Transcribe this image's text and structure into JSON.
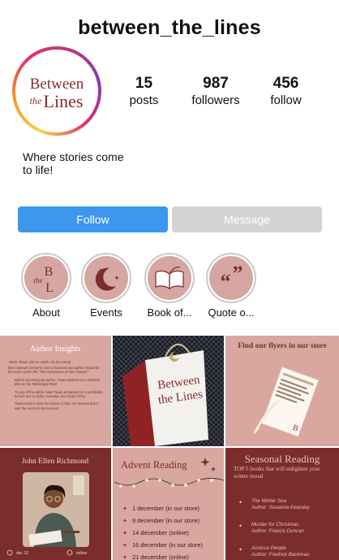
{
  "profile": {
    "username": "between_the_lines",
    "logo_line1": "Between",
    "logo_the": "the",
    "logo_line2": "Lines",
    "bio": "Where stories come to life!"
  },
  "stats": [
    {
      "value": "15",
      "label": "posts"
    },
    {
      "value": "987",
      "label": "followers"
    },
    {
      "value": "456",
      "label": "follow"
    }
  ],
  "buttons": {
    "follow": "Follow",
    "message": "Message"
  },
  "highlights": [
    {
      "label": "About",
      "icon": "btl-monogram-icon"
    },
    {
      "label": "Events",
      "icon": "moon-stars-icon"
    },
    {
      "label": "Book of...",
      "icon": "open-book-icon"
    },
    {
      "label": "Quote o...",
      "icon": "quote-marks-icon"
    }
  ],
  "posts": {
    "author_insights": {
      "title": "Author Insights",
      "line1": "Mark Twain (30.11.1835–21.04.1910)",
      "line2": "Born Samuel Clemens; was a humorist and author known for his iconic works like \"The Adventures of Tom Sawyer\"",
      "bullets": [
        "Before becoming an author, Twain worked as a riverboat pilot on the Mississippi River",
        "To pay off his debts, Mark Twain embarked on a worldwide lecture tour to India, Australia, and South Africa",
        "Twain used to write his stories in bed. He claimed that it was the secret to his success"
      ]
    },
    "bag": {
      "line1": "Between",
      "line2": "the Lines"
    },
    "flyers": {
      "title": "Find our flyers in our store"
    },
    "richmond": {
      "title": "John Ellen Richmond",
      "date": "dec 12",
      "mode": "online"
    },
    "advent": {
      "title": "Advent Reading",
      "items": [
        "1 december (in our store)",
        "9 december (in our store)",
        "14 december (online)",
        "16 december (in our store)",
        "21 december (online)"
      ]
    },
    "seasonal": {
      "title": "Seasonal Reading",
      "subtitle": "TOP 5 books that will enlighten your winter mood",
      "books": [
        {
          "title": "The Winter Sea",
          "author": "Author: Susanna Kearsley"
        },
        {
          "title": "Murder for Christmas",
          "author": "Author: Francis Duncan"
        },
        {
          "title": "Anxious People",
          "author": "Author: Fredrick Backman"
        }
      ]
    }
  },
  "colors": {
    "follow": "#3d97ef",
    "message": "#d3d3d3",
    "pink": "#d9a6a0",
    "maroon": "#7a2d2b",
    "logo": "#8b2a2a"
  }
}
